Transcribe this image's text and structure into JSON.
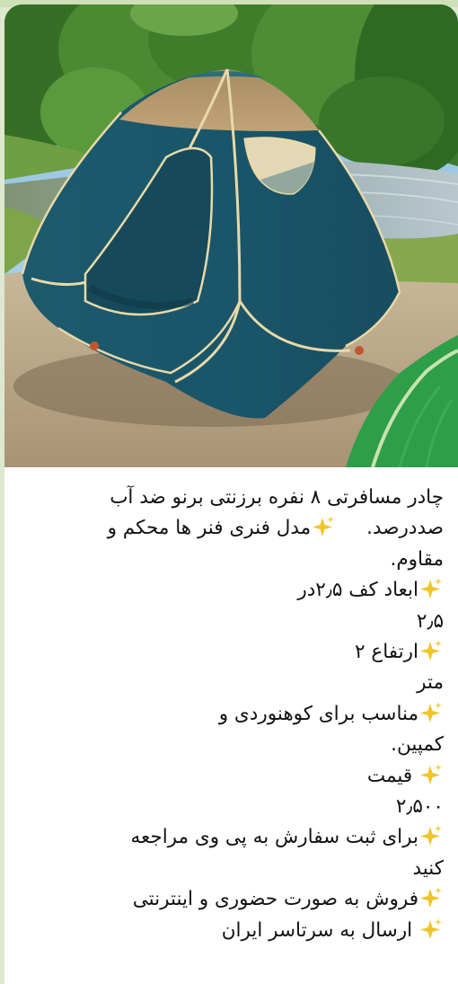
{
  "post": {
    "image_alt": "چادر مسافرتی کنار رودخانه",
    "colors": {
      "tent": "#1d5a6e",
      "roof": "#b49767",
      "trim": "#e9d9a8",
      "sparkle": "#f2c428"
    },
    "icons": {
      "bullet": "sparkles-icon"
    },
    "caption": {
      "line1": "چادر مسافرتی ۸ نفره برزنتی برنو ضد آب",
      "line2a": "صددرصد.",
      "line2b": "مدل فنری فنر ها محکم و",
      "line3": "مقاوم.",
      "line4": "ابعاد کف ۲٫۵در",
      "line5": "۲٫۵",
      "line6": "ارتفاع ۲",
      "line7": "متر",
      "line8": "مناسب برای کوهنوردی و",
      "line9": "کمپین.",
      "line10": "قیمت",
      "line11": "۲٫۵۰۰",
      "line12": "برای ثبت سفارش به پی وی مراجعه",
      "line13": "کنید",
      "line14": "فروش به صورت حضوری و اینترنتی",
      "line15": "ارسال به سرتاسر ایران"
    }
  }
}
